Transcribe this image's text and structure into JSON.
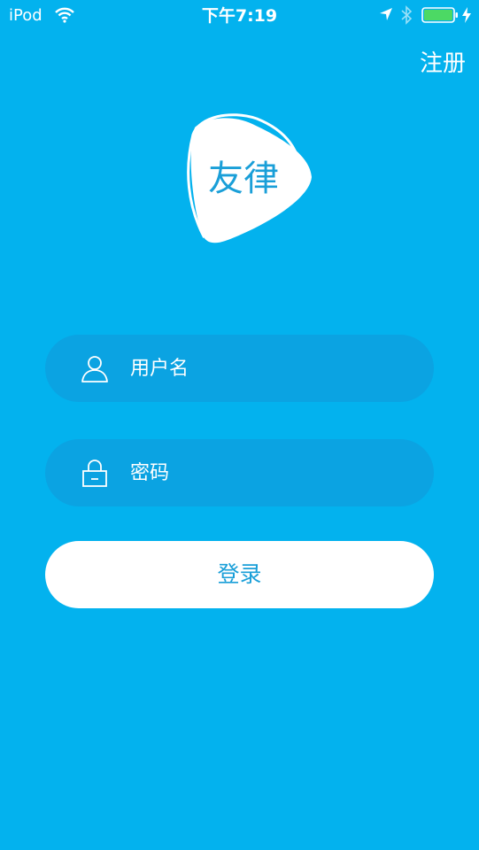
{
  "status_bar": {
    "carrier": "iPod",
    "time": "下午7:19",
    "icons": [
      "wifi-icon",
      "location-arrow-icon",
      "bluetooth-icon",
      "battery-icon",
      "charging-bolt-icon"
    ],
    "battery_level": 1.0,
    "battery_color": "#4cd964"
  },
  "header": {
    "register_label": "注册"
  },
  "logo": {
    "text": "友律",
    "text_color": "#1a9fd8"
  },
  "form": {
    "username": {
      "placeholder": "用户名",
      "value": "",
      "icon": "user-icon"
    },
    "password": {
      "placeholder": "密码",
      "value": "",
      "icon": "lock-icon"
    },
    "login_label": "登录"
  },
  "colors": {
    "background": "#03b2ee",
    "field_background": "#0ba3e2",
    "accent": "#1a9fd8",
    "button_background": "#ffffff"
  }
}
